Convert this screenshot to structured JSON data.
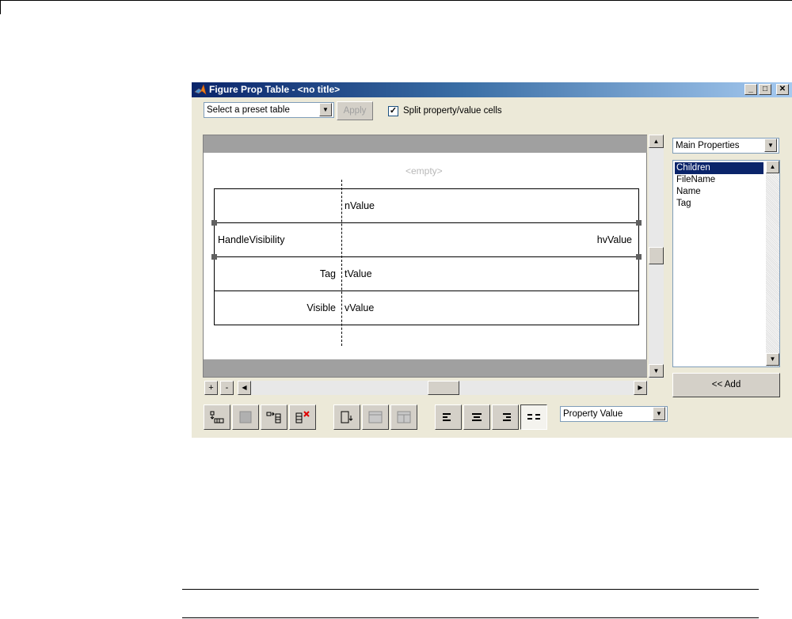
{
  "window": {
    "title": "Figure Prop Table - <no title>",
    "min_label": "_",
    "max_label": "□",
    "close_label": "✕"
  },
  "toolbar_top": {
    "preset_select": "Select a preset table",
    "apply_label": "Apply",
    "split_checked": true,
    "split_label": "Split property/value cells"
  },
  "canvas": {
    "empty_label": "<empty>",
    "rows": [
      {
        "property": "",
        "value": "nValue"
      },
      {
        "property": "HandleVisibility",
        "value": "hvValue"
      },
      {
        "property": "Tag",
        "value": "tValue"
      },
      {
        "property": "Visible",
        "value": "vValue"
      }
    ],
    "plus_label": "+",
    "minus_label": "-"
  },
  "side_panel": {
    "category_select": "Main Properties",
    "properties": [
      "Children",
      "FileName",
      "Name",
      "Tag"
    ],
    "selected_index": 0,
    "add_label": "<< Add"
  },
  "toolbar_bottom": {
    "alignment_select": "Property Value",
    "buttons": [
      {
        "icon": "insert-row-icon",
        "enabled": true
      },
      {
        "icon": "delete-row-icon",
        "enabled": false
      },
      {
        "icon": "insert-column-icon",
        "enabled": true
      },
      {
        "icon": "delete-column-icon",
        "enabled": true
      },
      {
        "icon": "insert-cell-icon",
        "enabled": true
      },
      {
        "icon": "merge-cells-icon",
        "enabled": false
      },
      {
        "icon": "split-cells-icon",
        "enabled": false
      },
      {
        "icon": "align-left-icon",
        "enabled": true
      },
      {
        "icon": "align-center-icon",
        "enabled": true
      },
      {
        "icon": "align-right-icon",
        "enabled": true
      },
      {
        "icon": "align-split-icon",
        "enabled": true,
        "pressed": true
      }
    ]
  },
  "colors": {
    "title_gradient_start": "#0a246a",
    "title_gradient_end": "#a6caf0",
    "selection": "#0a246a",
    "window_bg": "#ece9d8"
  }
}
